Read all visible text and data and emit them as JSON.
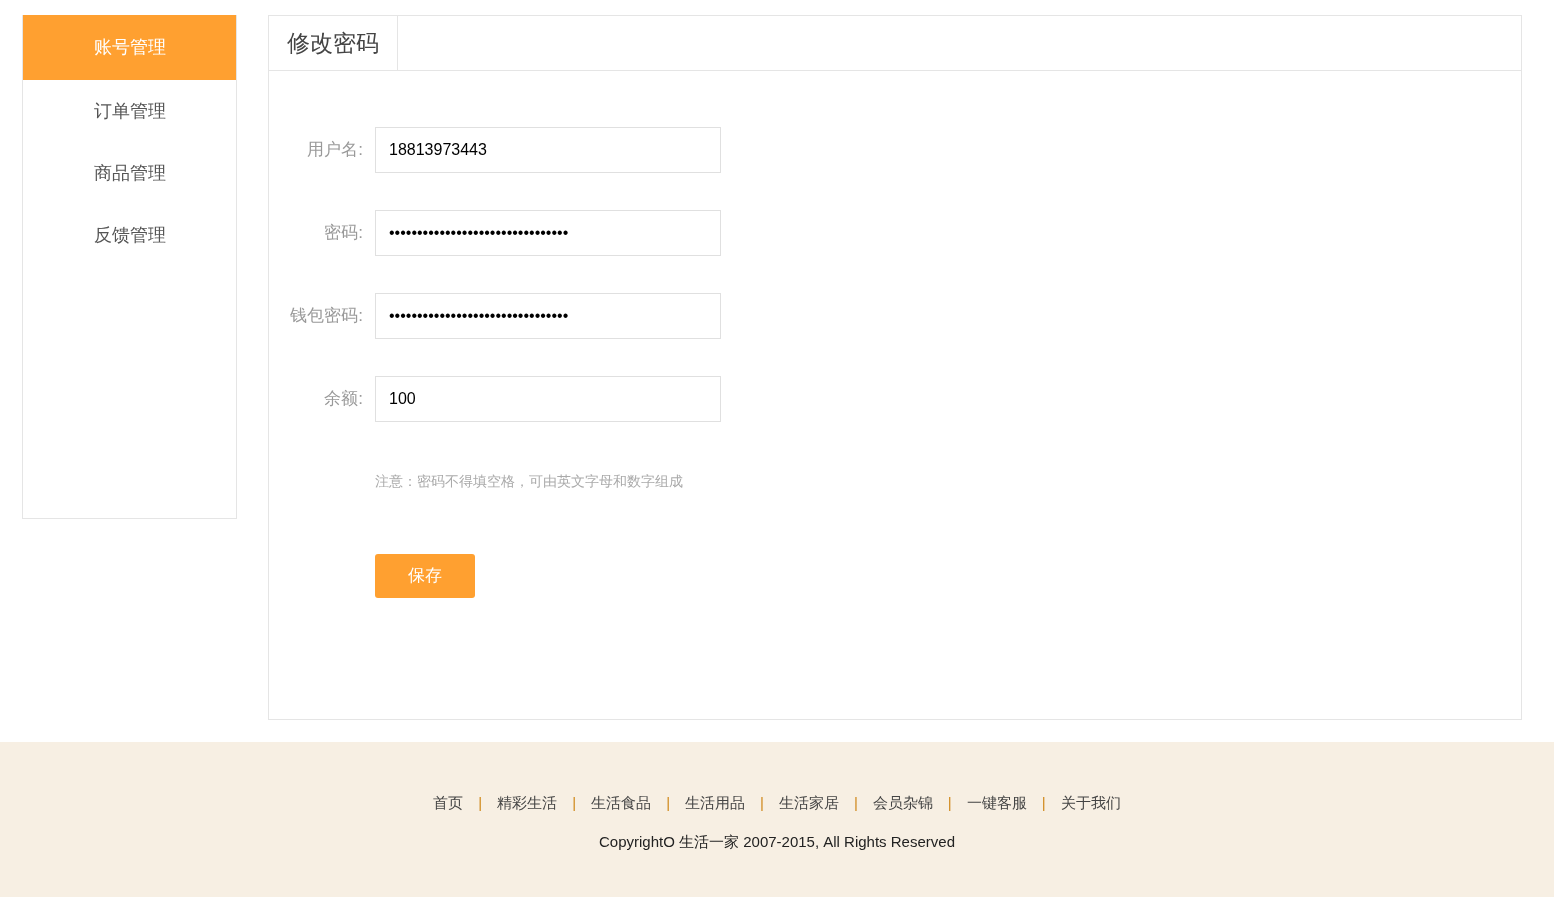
{
  "sidebar": {
    "items": [
      {
        "label": "账号管理",
        "selected": true
      },
      {
        "label": "订单管理",
        "selected": false
      },
      {
        "label": "商品管理",
        "selected": false
      },
      {
        "label": "反馈管理",
        "selected": false
      }
    ]
  },
  "panel": {
    "title": "修改密码",
    "fields": [
      {
        "label": "用户名:",
        "value": "18813973443"
      },
      {
        "label": "密码:",
        "value": "••••••••••••••••••••••••••••••••"
      },
      {
        "label": "钱包密码:",
        "value": "••••••••••••••••••••••••••••••••"
      },
      {
        "label": "余额:",
        "value": "100"
      }
    ],
    "note": "注意：密码不得填空格，可由英文字母和数字组成",
    "save_button": "保存"
  },
  "footer": {
    "links": [
      {
        "label": "首页",
        "separator": "|"
      },
      {
        "label": "精彩生活",
        "separator": "|"
      },
      {
        "label": "生活食品",
        "separator": "|"
      },
      {
        "label": "生活用品",
        "separator": "|"
      },
      {
        "label": "生活家居",
        "separator": "|"
      },
      {
        "label": "会员杂锦",
        "separator": "|"
      },
      {
        "label": "一键客服",
        "separator": "|"
      },
      {
        "label": "关于我们"
      }
    ],
    "copyright": "CopyrightO 生活一家 2007-2015, All Rights Reserved"
  }
}
